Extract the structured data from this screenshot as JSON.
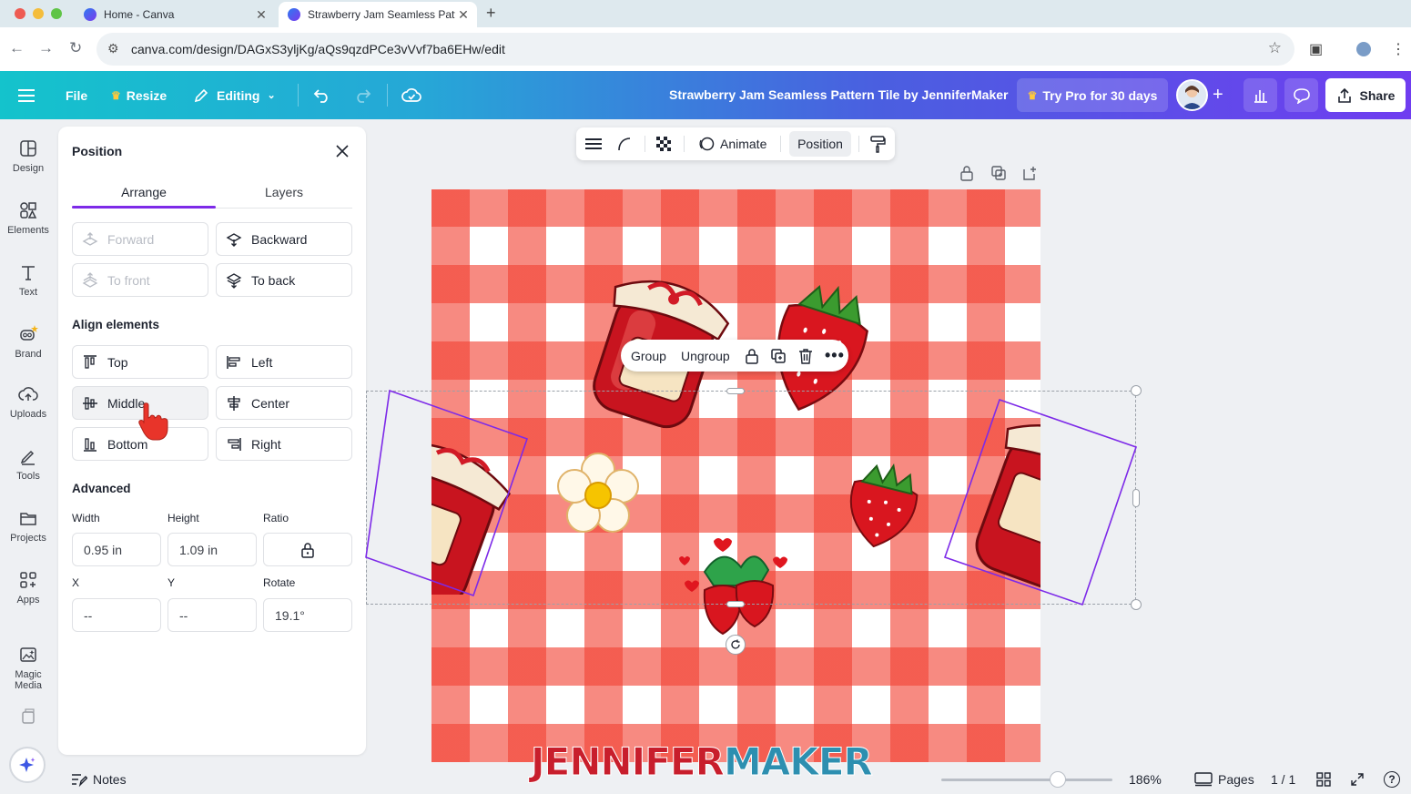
{
  "browser": {
    "tabs": [
      {
        "title": "Home - Canva",
        "active": false
      },
      {
        "title": "Strawberry Jam Seamless Pattern Tile by JenniferMaker",
        "active": true
      }
    ],
    "url": "canva.com/design/DAGxS3yljKg/aQs9qzdPCe3vVvf7ba6EHw/edit"
  },
  "header": {
    "menu_icon": "hamburger-icon",
    "file_label": "File",
    "resize_label": "Resize",
    "editing_label": "Editing",
    "design_title": "Strawberry Jam Seamless Pattern Tile by JenniferMaker",
    "pro_label": "Try Pro for 30 days",
    "share_label": "Share",
    "gradient_start": "#14c3cc",
    "gradient_end": "#6f3df0"
  },
  "rail": {
    "items": [
      {
        "label": "Design",
        "icon": "design-icon"
      },
      {
        "label": "Elements",
        "icon": "elements-icon"
      },
      {
        "label": "Text",
        "icon": "text-icon"
      },
      {
        "label": "Brand",
        "icon": "brand-icon"
      },
      {
        "label": "Uploads",
        "icon": "uploads-icon"
      },
      {
        "label": "Tools",
        "icon": "tools-icon"
      },
      {
        "label": "Projects",
        "icon": "projects-icon"
      },
      {
        "label": "Apps",
        "icon": "apps-icon"
      },
      {
        "label": "Magic Media",
        "icon": "magic-media-icon"
      }
    ]
  },
  "panel": {
    "title": "Position",
    "tabs": [
      "Arrange",
      "Layers"
    ],
    "arrange": {
      "forward": "Forward",
      "backward": "Backward",
      "to_front": "To front",
      "to_back": "To back"
    },
    "align_heading": "Align elements",
    "align": {
      "top": "Top",
      "left": "Left",
      "middle": "Middle",
      "center": "Center",
      "bottom": "Bottom",
      "right": "Right"
    },
    "advanced_heading": "Advanced",
    "fields": {
      "width_label": "Width",
      "width_value": "0.95 in",
      "height_label": "Height",
      "height_value": "1.09 in",
      "ratio_label": "Ratio",
      "x_label": "X",
      "x_value": "--",
      "y_label": "Y",
      "y_value": "--",
      "rotate_label": "Rotate",
      "rotate_value": "19.1°"
    }
  },
  "context_toolbar": {
    "animate_label": "Animate",
    "position_label": "Position"
  },
  "floating_bar": {
    "group_label": "Group",
    "ungroup_label": "Ungroup"
  },
  "canvas": {
    "accent_selection": "#7d2ae8",
    "gingham_red": "#f24234"
  },
  "watermark": {
    "part1": "JENNIFER",
    "part2": "MAKER",
    "color1": "#c81e2c",
    "color2": "#2d8fb0"
  },
  "bottom": {
    "notes_label": "Notes",
    "zoom": "186%",
    "zoom_fraction": 0.68,
    "pages_label": "Pages",
    "page_count": "1 / 1",
    "help": "?"
  }
}
